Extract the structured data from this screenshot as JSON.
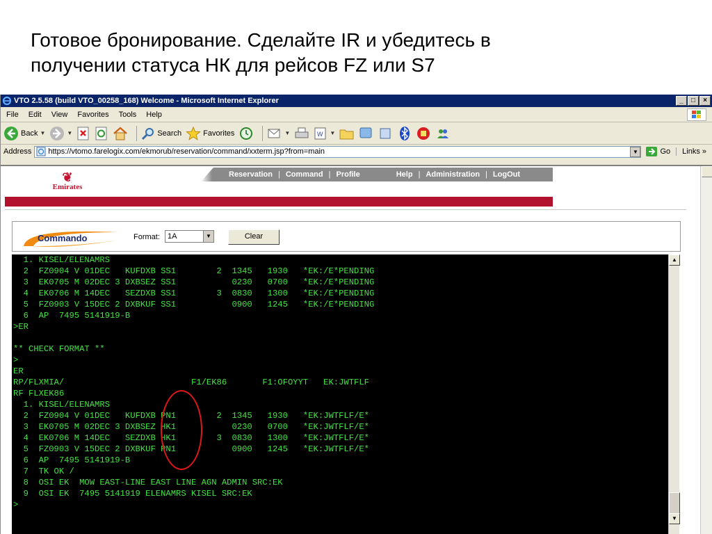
{
  "slide": {
    "title_line1": "Готовое бронирование. Сделайте IR и убедитесь в",
    "title_line2": "получении статуса НК для рейсов FZ или S7"
  },
  "window": {
    "title": "VTO 2.5.58 (build VTO_00258_168) Welcome - Microsoft Internet Explorer",
    "minimize": "_",
    "maximize": "□",
    "close": "×"
  },
  "menu": {
    "items": [
      "File",
      "Edit",
      "View",
      "Favorites",
      "Tools",
      "Help"
    ]
  },
  "toolbar": {
    "back_label": "Back",
    "search_label": "Search",
    "favorites_label": "Favorites"
  },
  "address": {
    "label": "Address",
    "url": "https://vtomo.farelogix.com/ekmorub/reservation/command/xxterm.jsp?from=main",
    "go_label": "Go",
    "links_label": "Links »"
  },
  "ek": {
    "logo_text": "Emirates",
    "nav_left": [
      "Reservation",
      "Command",
      "Profile"
    ],
    "nav_right": [
      "Help",
      "Administration",
      "LogOut"
    ]
  },
  "commando": {
    "logo_text": "Commando",
    "format_label": "Format:",
    "format_value": "1A",
    "clear_label": "Clear"
  },
  "terminal": {
    "lines": [
      "  1. KISEL/ELENAMRS",
      "  2  FZ0904 V 01DEC   KUFDXB SS1        2  1345   1930   *EK:/E*PENDING",
      "  3  EK0705 M 02DEC 3 DXBSEZ SS1           0230   0700   *EK:/E*PENDING",
      "  4  EK0706 M 14DEC   SEZDXB SS1        3  0830   1300   *EK:/E*PENDING",
      "  5  FZ0903 V 15DEC 2 DXBKUF SS1           0900   1245   *EK:/E*PENDING",
      "  6  AP  7495 5141919-B",
      ">ER",
      "",
      "** CHECK FORMAT **",
      ">",
      "ER",
      "RP/FLXMIA/                         F1/EK86       F1:OFOYYT   EK:JWTFLF",
      "RF FLXEK86",
      "  1. KISEL/ELENAMRS",
      "  2  FZ0904 V 01DEC   KUFDXB PN1        2  1345   1930   *EK:JWTFLF/E*",
      "  3  EK0705 M 02DEC 3 DXBSEZ HK1           0230   0700   *EK:JWTFLF/E*",
      "  4  EK0706 M 14DEC   SEZDXB HK1        3  0830   1300   *EK:JWTFLF/E*",
      "  5  FZ0903 V 15DEC 2 DXBKUF PN1           0900   1245   *EK:JWTFLF/E*",
      "  6  AP  7495 5141919-B",
      "  7  TK OK /",
      "  8  OSI EK  MOW EAST-LINE EAST LINE AGN ADMIN SRC:EK",
      "  9  OSI EK  7495 5141919 ELENAMRS KISEL SRC:EK",
      ">"
    ]
  },
  "colors": {
    "terminal_text": "#44e244",
    "terminal_bg": "#000000",
    "emirates_red": "#b3122e",
    "annotation_red": "#e01818",
    "titlebar_blue": "#0a246a"
  }
}
